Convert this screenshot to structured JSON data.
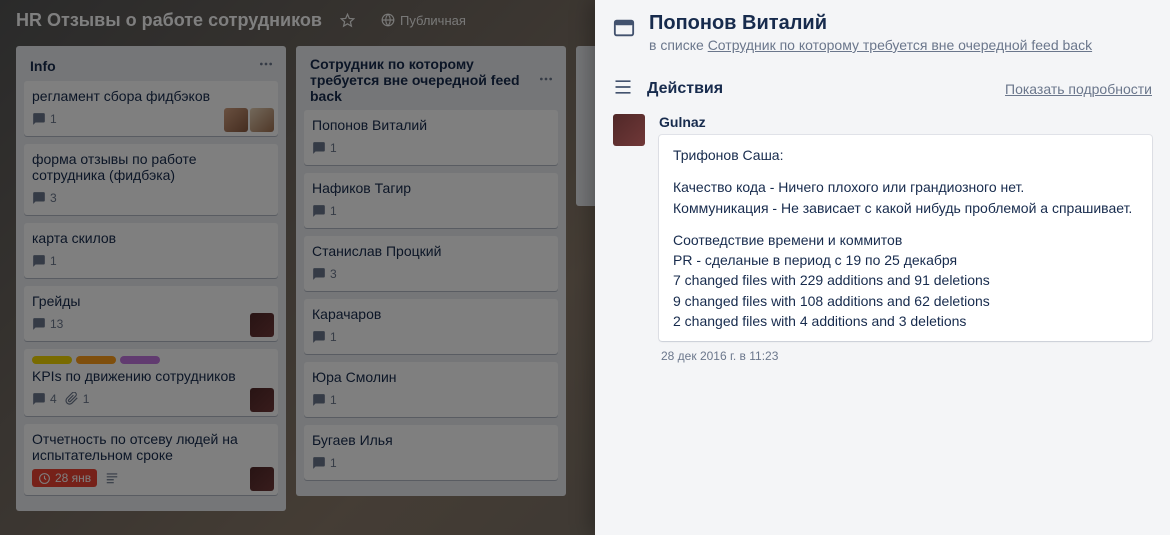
{
  "board": {
    "title": "HR Отзывы о работе сотрудников",
    "visibility": "Публичная"
  },
  "lists": [
    {
      "title": "Info",
      "cards": [
        {
          "title": "регламент сбора фидбэков",
          "comments": "1",
          "members": 2,
          "labels": [],
          "due": null,
          "attach": null
        },
        {
          "title": "форма отзывы по работе сотрудника (фидбэка)",
          "comments": "3",
          "members": 0,
          "labels": [],
          "due": null,
          "attach": null
        },
        {
          "title": "карта скилов",
          "comments": "1",
          "members": 0,
          "labels": [],
          "due": null,
          "attach": null
        },
        {
          "title": "Грейды",
          "comments": "13",
          "members": 1,
          "labels": [],
          "due": null,
          "attach": null
        },
        {
          "title": "KPIs по движению сотрудников",
          "comments": "4",
          "members": 1,
          "labels": [
            "y",
            "o",
            "p"
          ],
          "due": null,
          "attach": "1"
        },
        {
          "title": "Отчетность по отсеву людей на испытательном сроке",
          "comments": null,
          "members": 1,
          "labels": [],
          "due": "28 янв",
          "attach": null,
          "desc": true
        }
      ]
    },
    {
      "title": "Сотрудник по которому требуется вне очередной feed back",
      "cards": [
        {
          "title": "Попонов Виталий",
          "comments": "1"
        },
        {
          "title": "Нафиков Тагир",
          "comments": "1"
        },
        {
          "title": "Станислав Процкий",
          "comments": "3"
        },
        {
          "title": "Карачаров",
          "comments": "1"
        },
        {
          "title": "Юра Смолин",
          "comments": "1"
        },
        {
          "title": "Бугаев Илья",
          "comments": "1"
        }
      ]
    }
  ],
  "modal": {
    "title": "Попонов Виталий",
    "in_list_prefix": "в списке ",
    "in_list": "Сотрудник по которому требуется вне очередной feed back",
    "section_activity": "Действия",
    "show_details": "Показать подробности",
    "activity": {
      "user": "Gulnaz",
      "comment_p1": "Трифонов Саша:",
      "comment_p2": "Качество кода - Ничего плохого или грандиозного нет.\nКоммуникация - Не зависает с какой нибудь проблемой а спрашивает.",
      "comment_p3": "Соотведствие времени и коммитов\nPR - сделаные в период с 19 по 25 декабря\n7 changed files with 229 additions and 91 deletions\n9 changed files with 108 additions and 62 deletions\n2 changed files with 4 additions and 3 deletions",
      "timestamp": "28 дек 2016 г. в 11:23"
    }
  }
}
